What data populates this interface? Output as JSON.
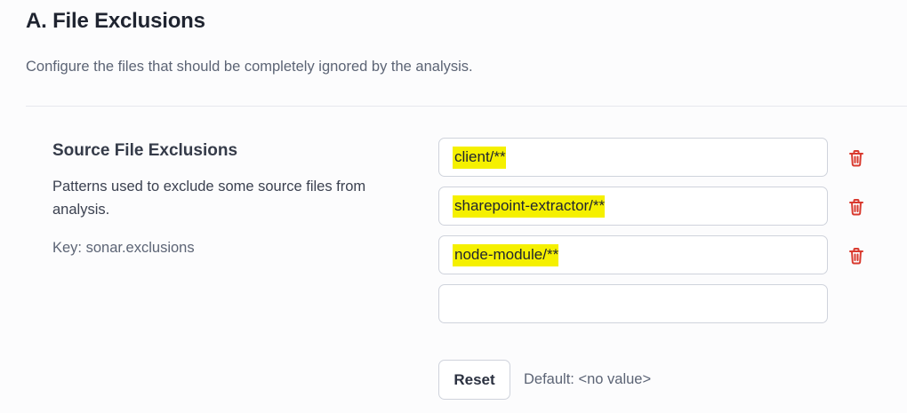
{
  "section": {
    "title": "A. File Exclusions",
    "description": "Configure the files that should be completely ignored by the analysis."
  },
  "setting": {
    "name": "Source File Exclusions",
    "description": "Patterns used to exclude some source files from analysis.",
    "key": "Key: sonar.exclusions"
  },
  "values": [
    {
      "text": "client/**",
      "highlighted": true
    },
    {
      "text": "sharepoint-extractor/**",
      "highlighted": true
    },
    {
      "text": "node-module/**",
      "highlighted": true
    },
    {
      "text": "",
      "highlighted": false
    }
  ],
  "actions": {
    "reset_label": "Reset",
    "default_text": "Default: <no value>"
  },
  "icons": {
    "delete": "trash-icon"
  },
  "colors": {
    "highlight": "#f5f000",
    "delete_icon": "#d93a2f"
  }
}
